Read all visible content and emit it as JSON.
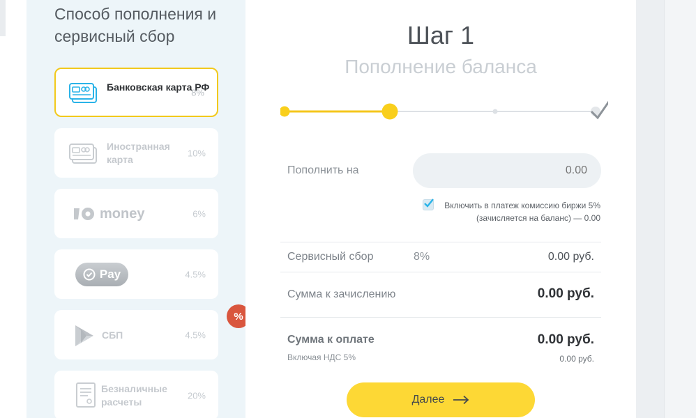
{
  "sidebar": {
    "title": "Способ пополнения и сервисный сбор",
    "methods": [
      {
        "label": "Банковская карта РФ",
        "percent": "8%",
        "selected": true
      },
      {
        "label": "Иностранная карта",
        "percent": "10%"
      },
      {
        "label": "money",
        "percent": "6%"
      },
      {
        "label": "Pay",
        "percent": "4.5%"
      },
      {
        "label": "СБП",
        "percent": "4.5%",
        "badge": "%"
      },
      {
        "label": "Безналичные расчеты",
        "percent": "20%"
      }
    ]
  },
  "step": {
    "title": "Шаг 1",
    "subtitle": "Пополнение баланса",
    "progress": {
      "current_step": 2,
      "total_steps": 4
    }
  },
  "form": {
    "topup_label": "Пополнить на",
    "topup_placeholder": "0.00",
    "include_fee_text": "Включить в платеж комиссию биржи 5% (зачисляется на баланс) — 0.00",
    "include_fee_checked": true
  },
  "summary": {
    "service_fee_label": "Сервисный сбор",
    "service_fee_percent": "8%",
    "service_fee_value": "0.00 руб.",
    "credit_label": "Сумма к зачислению",
    "credit_value": "0.00 руб.",
    "pay_label": "Сумма к оплате",
    "pay_value": "0.00 руб.",
    "vat_label": "Включая НДС 5%",
    "vat_value": "0.00 руб."
  },
  "actions": {
    "next_label": "Далее"
  },
  "colors": {
    "accent": "#fdd835",
    "selected_border": "#f2c91c",
    "badge": "#d9563e",
    "card_blue": "#2ab3e8"
  }
}
